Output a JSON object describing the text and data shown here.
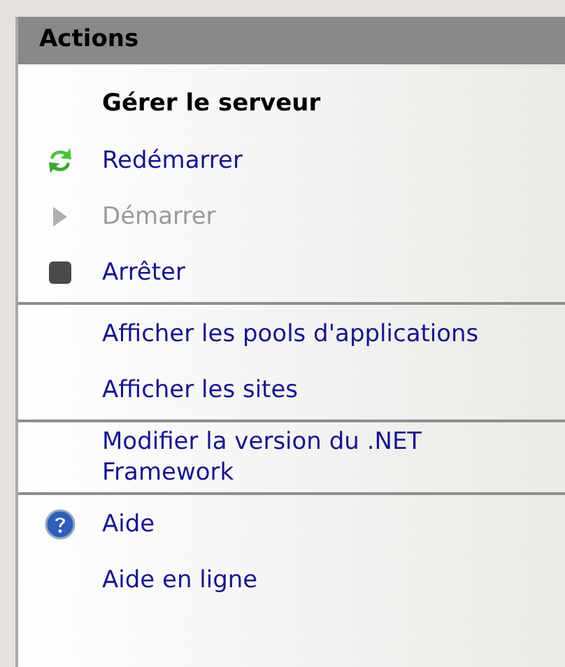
{
  "panel": {
    "title": "Actions"
  },
  "groups": [
    {
      "items": [
        {
          "kind": "heading",
          "label": "Gérer le serveur"
        },
        {
          "kind": "restart",
          "label": "Redémarrer",
          "disabled": false
        },
        {
          "kind": "start",
          "label": "Démarrer",
          "disabled": true
        },
        {
          "kind": "stop",
          "label": "Arrêter",
          "disabled": false
        }
      ]
    },
    {
      "items": [
        {
          "kind": "link",
          "label": "Afficher les pools d'applications",
          "disabled": false
        },
        {
          "kind": "link",
          "label": "Afficher les sites",
          "disabled": false
        }
      ]
    },
    {
      "items": [
        {
          "kind": "link",
          "label": "Modifier la version du .NET Framework",
          "disabled": false
        }
      ]
    },
    {
      "items": [
        {
          "kind": "help",
          "label": "Aide",
          "disabled": false
        },
        {
          "kind": "link",
          "label": "Aide en ligne",
          "disabled": false
        }
      ]
    }
  ]
}
